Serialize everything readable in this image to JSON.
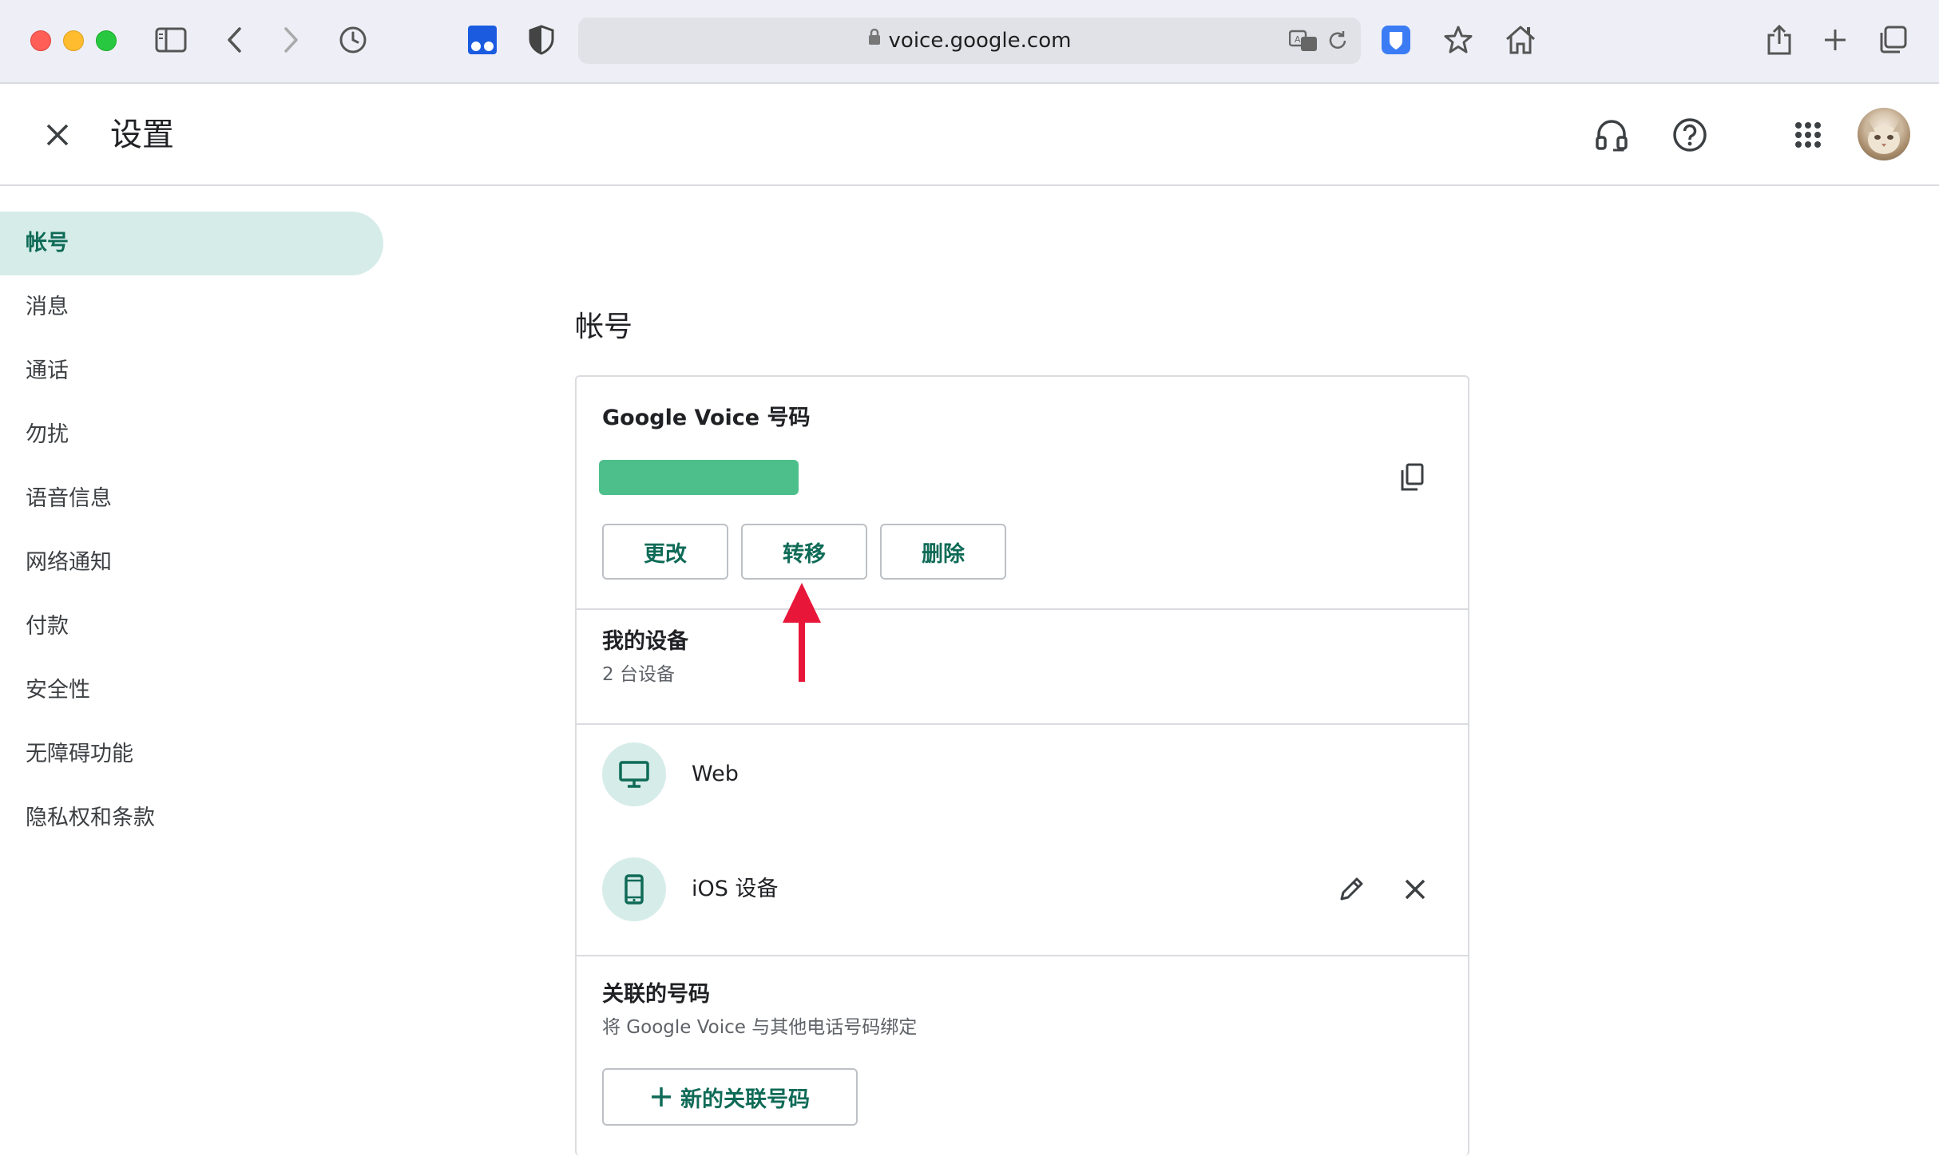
{
  "browser": {
    "url": "voice.google.com"
  },
  "header": {
    "title": "设置"
  },
  "sidebar": {
    "items": [
      {
        "label": "帐号",
        "active": true
      },
      {
        "label": "消息"
      },
      {
        "label": "通话"
      },
      {
        "label": "勿扰"
      },
      {
        "label": "语音信息"
      },
      {
        "label": "网络通知"
      },
      {
        "label": "付款"
      },
      {
        "label": "安全性"
      },
      {
        "label": "无障碍功能"
      },
      {
        "label": "隐私权和条款"
      }
    ]
  },
  "main": {
    "section_title": "帐号",
    "voice_number": {
      "heading": "Google Voice 号码",
      "buttons": {
        "change": "更改",
        "transfer": "转移",
        "delete": "删除"
      }
    },
    "devices": {
      "heading": "我的设备",
      "count": "2 台设备",
      "items": [
        {
          "label": "Web",
          "icon": "monitor-icon"
        },
        {
          "label": "iOS 设备",
          "icon": "phone-icon"
        }
      ]
    },
    "linked": {
      "heading": "关联的号码",
      "subtitle": "将 Google Voice 与其他电话号码绑定",
      "add_button": "新的关联号码"
    }
  },
  "colors": {
    "accent": "#0f6b57",
    "active_bg": "#d6ece9",
    "redacted": "#4dbf8b",
    "annotation_arrow": "#e8173a"
  }
}
